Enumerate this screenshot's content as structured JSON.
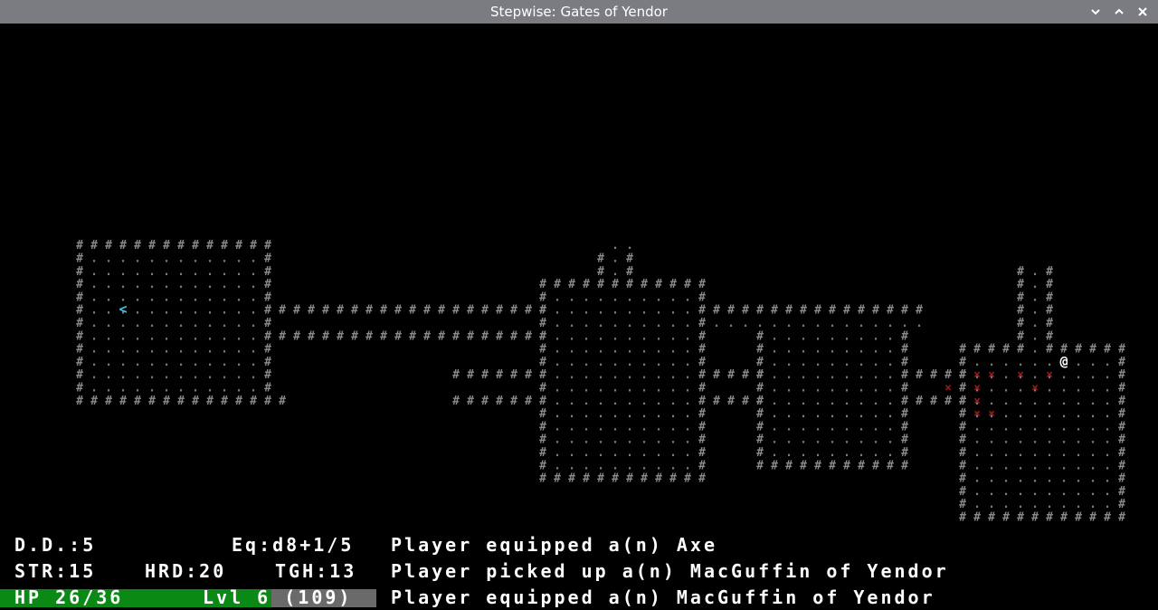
{
  "window": {
    "title": "Stepwise: Gates of Yendor"
  },
  "map": {
    "wall_color": "#8a8a8a",
    "floor_color": "#7a7a7a",
    "stair_color": "#3ec8d8",
    "player_color": "#ffffff",
    "trap_color": "#a01818"
  },
  "hud": {
    "depth": "D.D.:5",
    "equip": "Eq:d8+1/5",
    "str": "STR:15",
    "hrd": "HRD:20",
    "tgh": "TGH:13",
    "hp": "HP 26/36",
    "hp_fraction": 0.722,
    "level": "Lvl 6 (109)",
    "hp_color": "#0a8a14",
    "messages": [
      "Player equipped a(n) Axe",
      "Player picked up a(n) MacGuffin of Yendor",
      "Player equipped a(n) MacGuffin of Yendor"
    ]
  }
}
